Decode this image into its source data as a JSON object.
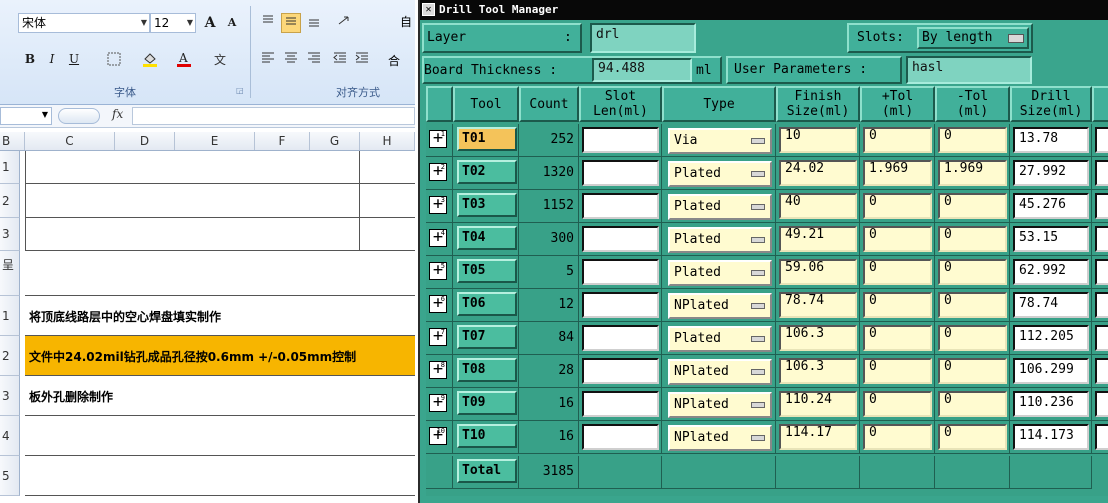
{
  "excel": {
    "font_name": "宋体",
    "font_size": "12",
    "group_font_label": "字体",
    "group_align_label": "对齐方式",
    "wrap_partial": "自",
    "merge_partial": "合",
    "bold": "B",
    "italic": "I",
    "underline": "U",
    "grow_font": "A",
    "shrink_font": "A",
    "fx_label": "fx",
    "columns": [
      "B",
      "C",
      "D",
      "E",
      "F",
      "G",
      "H"
    ],
    "row_headers": [
      "1",
      "2",
      "3",
      "呈",
      "1",
      "2",
      "3",
      "4",
      "5"
    ],
    "rows": [
      {
        "text": ""
      },
      {
        "text": ""
      },
      {
        "text": ""
      },
      {
        "text": ""
      },
      {
        "text": "将顶底线路层中的空心焊盘填实制作"
      },
      {
        "text": "文件中24.02mil钻孔成品孔径按0.6mm +/-0.05mm控制"
      },
      {
        "text": "板外孔删除制作"
      },
      {
        "text": ""
      },
      {
        "text": ""
      }
    ],
    "highlight_color": "#f7b500"
  },
  "dtm": {
    "title": "Drill Tool Manager",
    "layer_label": "Layer",
    "layer_colon": ":",
    "layer_value": "drl",
    "slots_label": "Slots:",
    "slots_value": "By length",
    "board_thickness_label": "Board Thickness :",
    "board_thickness_value": "94.488",
    "board_thickness_unit": "ml",
    "user_params_label": "User Parameters :",
    "user_params_value": "hasl",
    "headers": {
      "tool": "Tool",
      "count": "Count",
      "slot_len": "Slot\nLen(ml)",
      "type": "Type",
      "finish_size": "Finish\nSize(ml)",
      "plus_tol": "+Tol\n(ml)",
      "minus_tol": "-Tol\n(ml)",
      "drill_size": "Drill\nSize(ml)"
    },
    "rows": [
      {
        "tool": "T01",
        "count": "252",
        "slot": "",
        "type": "Via",
        "finish": "10",
        "plus": "0",
        "minus": "0",
        "drill": "13.78",
        "badge": "1"
      },
      {
        "tool": "T02",
        "count": "1320",
        "slot": "",
        "type": "Plated",
        "finish": "24.02",
        "plus": "1.969",
        "minus": "1.969",
        "drill": "27.992",
        "badge": "2"
      },
      {
        "tool": "T03",
        "count": "1152",
        "slot": "",
        "type": "Plated",
        "finish": "40",
        "plus": "0",
        "minus": "0",
        "drill": "45.276",
        "badge": "3"
      },
      {
        "tool": "T04",
        "count": "300",
        "slot": "",
        "type": "Plated",
        "finish": "49.21",
        "plus": "0",
        "minus": "0",
        "drill": "53.15",
        "badge": "4"
      },
      {
        "tool": "T05",
        "count": "5",
        "slot": "",
        "type": "Plated",
        "finish": "59.06",
        "plus": "0",
        "minus": "0",
        "drill": "62.992",
        "badge": "5"
      },
      {
        "tool": "T06",
        "count": "12",
        "slot": "",
        "type": "NPlated",
        "finish": "78.74",
        "plus": "0",
        "minus": "0",
        "drill": "78.74",
        "badge": "6"
      },
      {
        "tool": "T07",
        "count": "84",
        "slot": "",
        "type": "Plated",
        "finish": "106.3",
        "plus": "0",
        "minus": "0",
        "drill": "112.205",
        "badge": "7"
      },
      {
        "tool": "T08",
        "count": "28",
        "slot": "",
        "type": "NPlated",
        "finish": "106.3",
        "plus": "0",
        "minus": "0",
        "drill": "106.299",
        "badge": "8"
      },
      {
        "tool": "T09",
        "count": "16",
        "slot": "",
        "type": "NPlated",
        "finish": "110.24",
        "plus": "0",
        "minus": "0",
        "drill": "110.236",
        "badge": "9"
      },
      {
        "tool": "T10",
        "count": "16",
        "slot": "",
        "type": "NPlated",
        "finish": "114.17",
        "plus": "0",
        "minus": "0",
        "drill": "114.173",
        "badge": "10"
      }
    ],
    "total_label": "Total",
    "total_count": "3185",
    "active_tool_color": "#f4c35a",
    "panel_color": "#3aa58d"
  }
}
